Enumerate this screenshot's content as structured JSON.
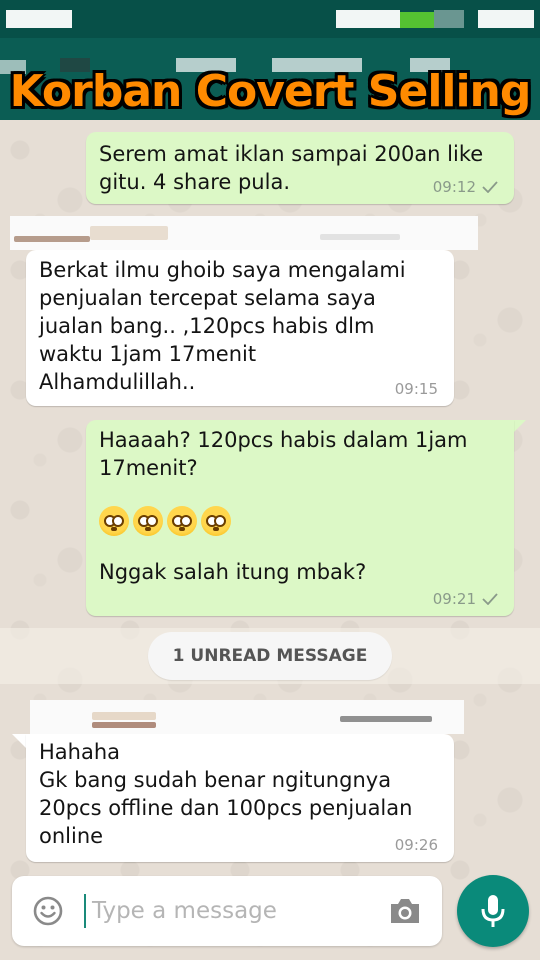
{
  "header": {
    "overlay_title": "Korban Covert Selling"
  },
  "messages": [
    {
      "direction": "out",
      "text": "Serem amat iklan sampai 200an like\ngitu. 4 share pula.",
      "time": "09:12",
      "status": "sent"
    },
    {
      "direction": "in",
      "text": "Berkat ilmu ghoib saya mengalami\npenjualan tercepat selama saya\njualan bang.. ,120pcs habis dlm\nwaktu 1jam 17menit\nAlhamdulillah..",
      "time": "09:15"
    },
    {
      "direction": "out",
      "text_line1": "Haaaah? 120pcs habis dalam 1jam\n17menit?",
      "emoji_count": 4,
      "text_line2": "Nggak salah itung mbak?",
      "time": "09:21",
      "status": "sent"
    },
    {
      "direction": "in",
      "text": "Hahaha\nGk bang sudah benar ngitungnya\n20pcs offline dan 100pcs penjualan\nonline",
      "time": "09:26"
    }
  ],
  "unread_label": "1 UNREAD MESSAGE",
  "composer": {
    "placeholder": "Type a message"
  },
  "colors": {
    "header_bg": "#0b5d54",
    "outgoing_bubble": "#dcf8c6",
    "incoming_bubble": "#ffffff",
    "mic_button": "#0a8a7a",
    "title_orange": "#ff8a00"
  },
  "icons": [
    "emoji-icon",
    "camera-icon",
    "mic-icon",
    "check-icon",
    "flushed-face-emoji"
  ]
}
